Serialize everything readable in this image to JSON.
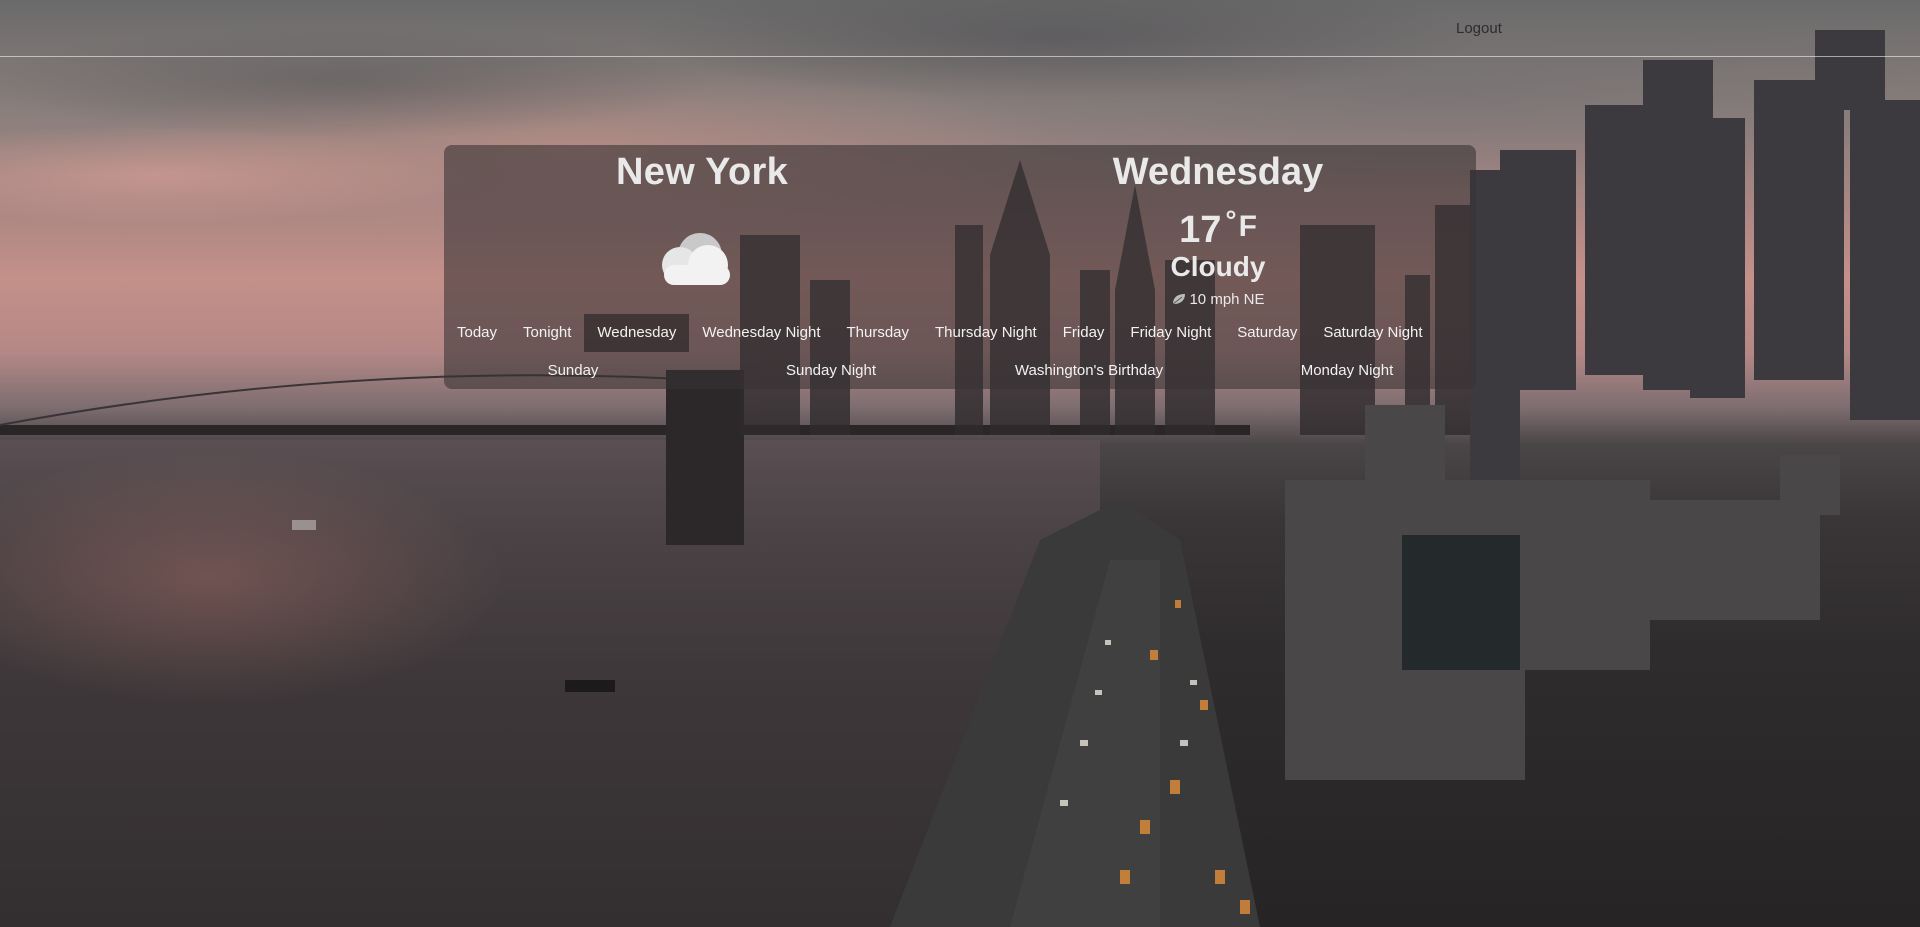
{
  "nav": {
    "logout_label": "Logout"
  },
  "weather": {
    "city": "New York",
    "selected_day": "Wednesday",
    "temperature": "17",
    "degree_symbol": "°",
    "unit": "F",
    "condition": "Cloudy",
    "wind": "10 mph NE",
    "icon": "cloud-icon"
  },
  "tabs_row1": [
    "Today",
    "Tonight",
    "Wednesday",
    "Wednesday Night",
    "Thursday",
    "Thursday Night",
    "Friday",
    "Friday Night",
    "Saturday",
    "Saturday Night"
  ],
  "tabs_row2": [
    "Sunday",
    "Sunday Night",
    "Washington's Birthday",
    "Monday Night"
  ],
  "active_tab": "Wednesday",
  "colors": {
    "card_background": "#373234",
    "text": "#e9e9e9",
    "nav_text": "#2d2d2d"
  }
}
